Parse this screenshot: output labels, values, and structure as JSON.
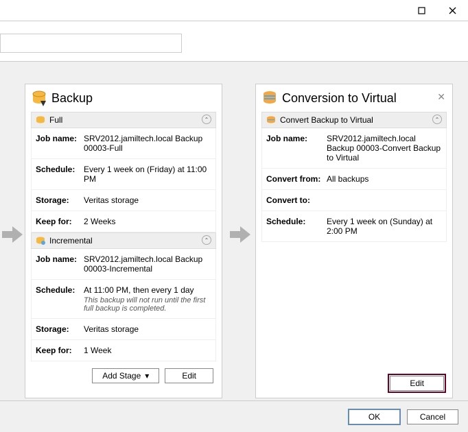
{
  "window": {
    "maximize": "☐",
    "close": "✕"
  },
  "backup": {
    "title": "Backup",
    "full": {
      "header": "Full",
      "job_label": "Job name:",
      "job_val": "SRV2012.jamiltech.local Backup 00003-Full",
      "sched_label": "Schedule:",
      "sched_val": "Every 1 week on (Friday) at 11:00 PM",
      "storage_label": "Storage:",
      "storage_val": "Veritas storage",
      "keep_label": "Keep for:",
      "keep_val": "2 Weeks"
    },
    "incr": {
      "header": "Incremental",
      "job_label": "Job name:",
      "job_val": "SRV2012.jamiltech.local Backup 00003-Incremental",
      "sched_label": "Schedule:",
      "sched_val": "At 11:00 PM, then every 1 day",
      "sched_note": "This backup will not run until the first full backup is completed.",
      "storage_label": "Storage:",
      "storage_val": "Veritas storage",
      "keep_label": "Keep for:",
      "keep_val": "1 Week"
    },
    "add_stage": "Add Stage",
    "edit": "Edit"
  },
  "conversion": {
    "title": "Conversion to Virtual",
    "section": "Convert Backup to Virtual",
    "job_label": "Job name:",
    "job_val": "SRV2012.jamiltech.local Backup 00003-Convert Backup to Virtual",
    "from_label": "Convert from:",
    "from_val": "All backups",
    "to_label": "Convert to:",
    "to_val": "",
    "sched_label": "Schedule:",
    "sched_val": "Every 1 week on (Sunday) at 2:00 PM",
    "edit": "Edit"
  },
  "footer": {
    "ok": "OK",
    "cancel": "Cancel"
  }
}
